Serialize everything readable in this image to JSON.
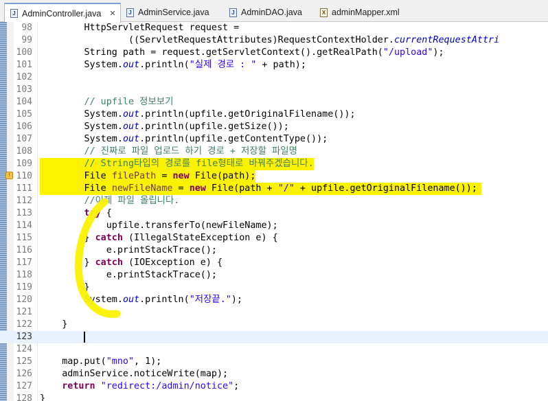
{
  "tabs": [
    {
      "label": "AdminController.java",
      "icon": "java-file-icon",
      "active": true
    },
    {
      "label": "AdminService.java",
      "icon": "java-file-icon",
      "active": false
    },
    {
      "label": "AdminDAO.java",
      "icon": "java-file-icon",
      "active": false
    },
    {
      "label": "adminMapper.xml",
      "icon": "xml-file-icon",
      "active": false
    }
  ],
  "editor": {
    "current_line": 123,
    "highlight_color": "#fbf200",
    "lines": [
      {
        "n": "98",
        "text": "        HttpServletRequest request ="
      },
      {
        "n": "99",
        "text": "                ((ServletRequestAttributes)RequestContextHolder.currentRequestAttri"
      },
      {
        "n": "100",
        "text": "        String path = request.getServletContext().getRealPath(\"/upload\");"
      },
      {
        "n": "101",
        "text": "        System.out.println(\"실제 경로 : \" + path);"
      },
      {
        "n": "102",
        "text": ""
      },
      {
        "n": "103",
        "text": ""
      },
      {
        "n": "104",
        "text": "        // upfile 정보보기"
      },
      {
        "n": "105",
        "text": "        System.out.println(upfile.getOriginalFilename());"
      },
      {
        "n": "106",
        "text": "        System.out.println(upfile.getSize());"
      },
      {
        "n": "107",
        "text": "        System.out.println(upfile.getContentType());"
      },
      {
        "n": "108",
        "text": "        // 진짜로 파일 업로드 하기 경로 + 저장할 파일명"
      },
      {
        "n": "109",
        "text": "        // String타입의 경로를 file형태로 바꿔주겠습니다."
      },
      {
        "n": "110",
        "text": "        File filePath = new File(path);"
      },
      {
        "n": "111",
        "text": "        File newFileName = new File(path + \"/\" + upfile.getOriginalFilename());"
      },
      {
        "n": "112",
        "text": "        //이제 파일 올립니다."
      },
      {
        "n": "113",
        "text": "        try {"
      },
      {
        "n": "114",
        "text": "            upfile.transferTo(newFileName);"
      },
      {
        "n": "115",
        "text": "        } catch (IllegalStateException e) {"
      },
      {
        "n": "116",
        "text": "            e.printStackTrace();"
      },
      {
        "n": "117",
        "text": "        } catch (IOException e) {"
      },
      {
        "n": "118",
        "text": "            e.printStackTrace();"
      },
      {
        "n": "119",
        "text": "        }"
      },
      {
        "n": "120",
        "text": "        System.out.println(\"저장끝.\");"
      },
      {
        "n": "121",
        "text": ""
      },
      {
        "n": "122",
        "text": "    }"
      },
      {
        "n": "123",
        "text": ""
      },
      {
        "n": "124",
        "text": ""
      },
      {
        "n": "125",
        "text": "    map.put(\"mno\", 1);"
      },
      {
        "n": "126",
        "text": "    adminService.noticeWrite(map);"
      },
      {
        "n": "127",
        "text": "    return \"redirect:/admin/notice\";"
      },
      {
        "n": "128",
        "text": "}"
      }
    ]
  }
}
